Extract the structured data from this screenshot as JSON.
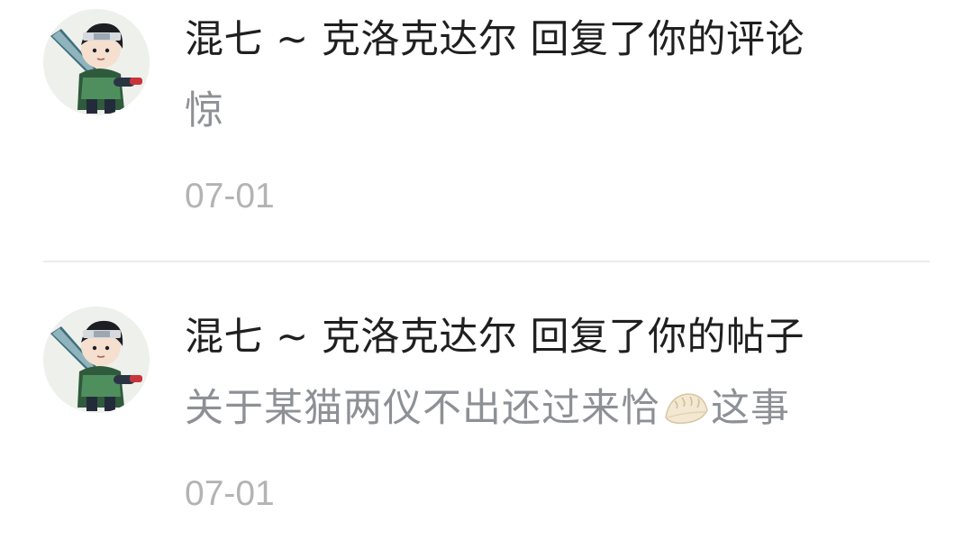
{
  "notifications": [
    {
      "title": "混七 ~ 克洛克达尔 回复了你的评论",
      "content": "惊",
      "content_parts": [],
      "time": "07-01",
      "avatar_icon": "ninja-avatar-icon"
    },
    {
      "title": "混七 ~ 克洛克达尔 回复了你的帖子",
      "content": "",
      "content_parts": [
        "关于某猫两仪不出还过来恰",
        "这事"
      ],
      "content_emoji": "dumpling-emoji",
      "time": "07-01",
      "avatar_icon": "ninja-avatar-icon"
    }
  ],
  "colors": {
    "title": "#1f1f1f",
    "body": "#8d9095",
    "time": "#b3b3b3",
    "divider": "#ececec"
  }
}
